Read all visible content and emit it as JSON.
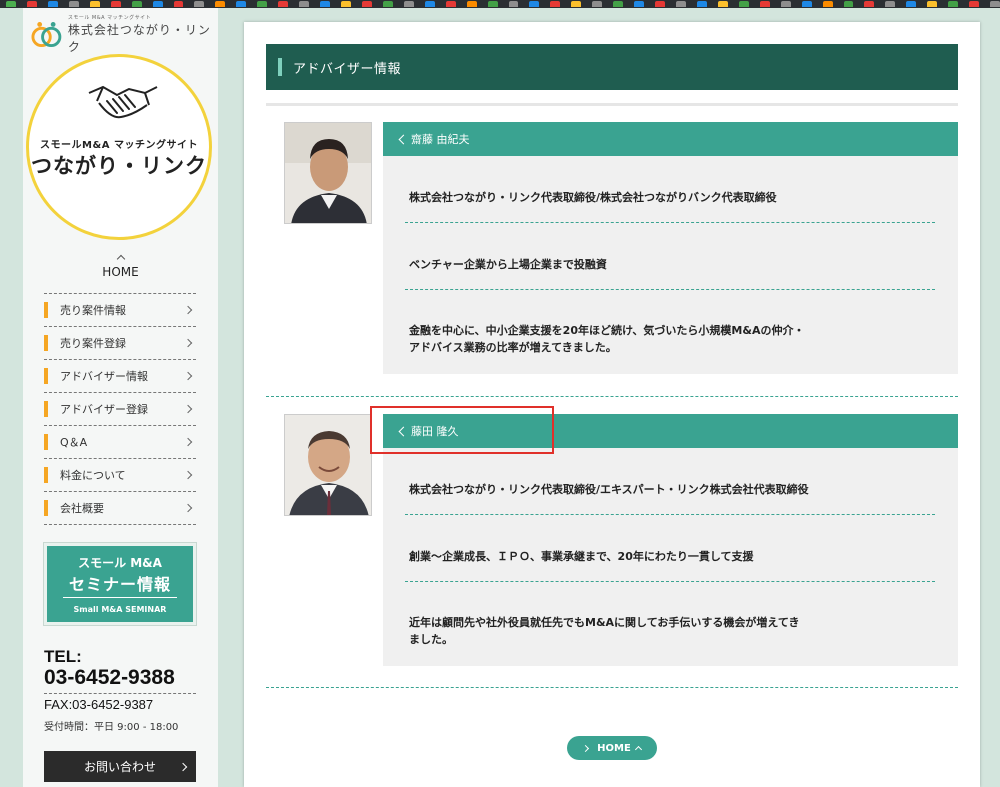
{
  "company": {
    "sub": "スモール M&A マッチングサイト",
    "name": "株式会社つながり・リンク"
  },
  "badge": {
    "line1": "スモールM&A マッチングサイト",
    "line2": "つながり・リンク"
  },
  "sidebar": {
    "home_label": "HOME",
    "items": [
      {
        "label": "売り案件情報"
      },
      {
        "label": "売り案件登録"
      },
      {
        "label": "アドバイザー情報"
      },
      {
        "label": "アドバイザー登録"
      },
      {
        "label": "Q＆A"
      },
      {
        "label": "料金について"
      },
      {
        "label": "会社概要"
      }
    ],
    "seminar": {
      "line1": "スモール M&A",
      "line2": "セミナー情報",
      "line3": "Small M&A SEMINAR"
    },
    "tel_label": "TEL:",
    "tel_number": "03-6452-9388",
    "fax": "FAX:03-6452-9387",
    "hours": "受付時間：平日 9:00 - 18:00",
    "contact_label": "お問い合わせ"
  },
  "main": {
    "title": "アドバイザー情報",
    "advisors": [
      {
        "name": "齋藤 由紀夫",
        "entries": [
          "株式会社つながり・リンク代表取締役/株式会社つながりバンク代表取締役",
          "ベンチャー企業から上場企業まで投融資",
          "金融を中心に、中小企業支援を20年ほど続け、気づいたら小規模M&Aの仲介・",
          "アドバイス業務の比率が増えてきました。"
        ]
      },
      {
        "name": "藤田 隆久",
        "entries": [
          "株式会社つながり・リンク代表取締役/エキスパート・リンク株式会社代表取締役",
          "創業～企業成長、ＩＰＯ、事業承継まで、20年にわたり一貫して支援",
          "近年は顧問先や社外役員就任先でもM&Aに関してお手伝いする機会が増えてき",
          "ました。"
        ]
      }
    ],
    "home_button": "HOME"
  },
  "colors": {
    "teal": "#3aa391",
    "dark_teal": "#1f5d50",
    "orange": "#f5a623",
    "yellow": "#f3d23c",
    "highlight_red": "#e0302a"
  }
}
